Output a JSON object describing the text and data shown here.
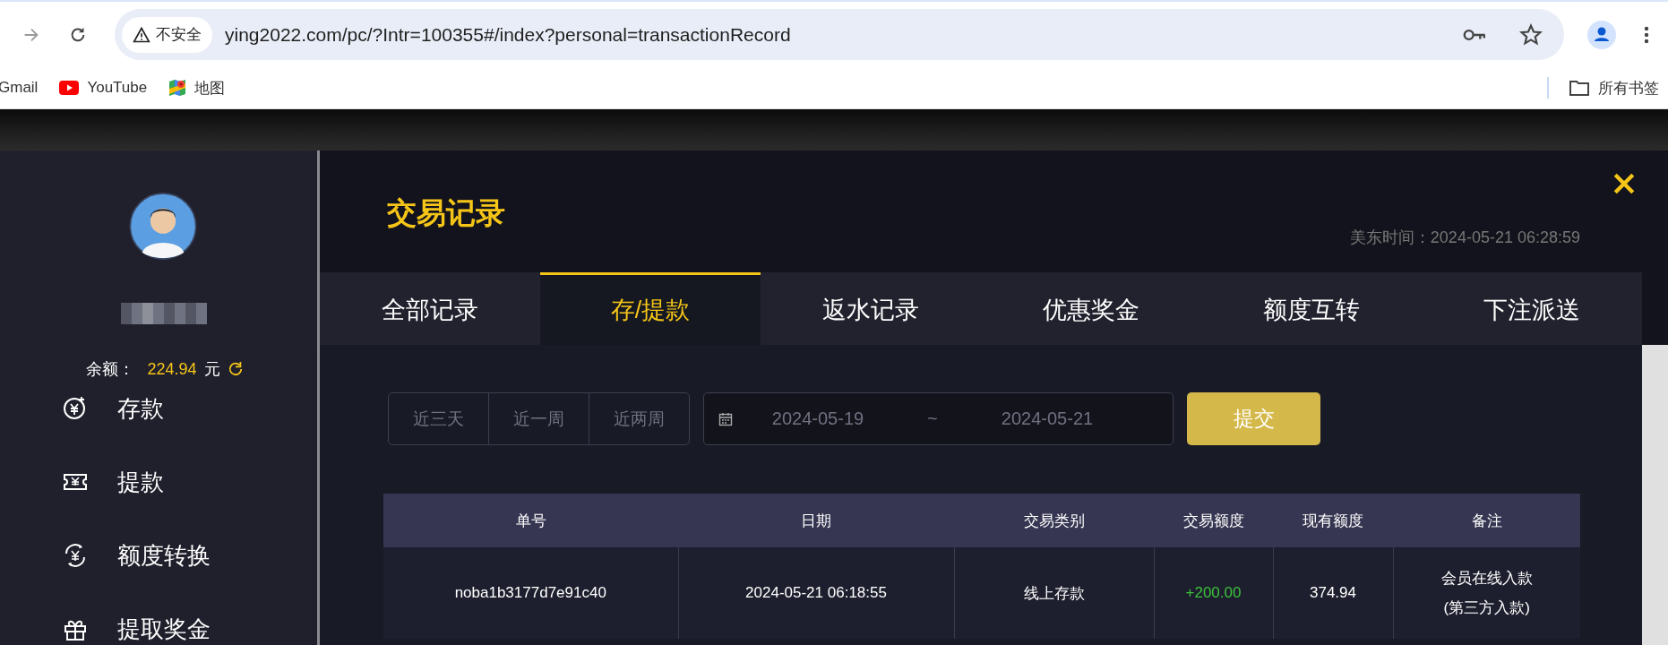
{
  "browser": {
    "security_label": "不安全",
    "url": "ying2022.com/pc/?Intr=100355#/index?personal=transactionRecord",
    "bookmarks": [
      {
        "label": "Gmail",
        "kind": "plain"
      },
      {
        "label": "YouTube",
        "kind": "youtube"
      },
      {
        "label": "地图",
        "kind": "maps"
      }
    ],
    "all_bookmarks": "所有书签"
  },
  "sidebar": {
    "balance_label": "余额：",
    "balance": "224.94",
    "currency": "元",
    "menu": [
      {
        "label": "存款",
        "kind": "deposit"
      },
      {
        "label": "提款",
        "kind": "withdraw"
      },
      {
        "label": "额度转换",
        "kind": "transfer"
      },
      {
        "label": "提取奖金",
        "kind": "gift"
      }
    ]
  },
  "panel": {
    "title": "交易记录",
    "time": "美东时间：2024-05-21 06:28:59",
    "tabs": [
      {
        "label": "全部记录",
        "selected": false
      },
      {
        "label": "存/提款",
        "selected": true
      },
      {
        "label": "返水记录",
        "selected": false
      },
      {
        "label": "优惠奖金",
        "selected": false
      },
      {
        "label": "额度互转",
        "selected": false
      },
      {
        "label": "下注派送",
        "selected": false
      }
    ],
    "quick_ranges": [
      "近三天",
      "近一周",
      "近两周"
    ],
    "date_from": "2024-05-19",
    "date_separator": "~",
    "date_to": "2024-05-21",
    "submit": "提交"
  },
  "table": {
    "columns": [
      "单号",
      "日期",
      "交易类别",
      "交易额度",
      "现有额度",
      "备注"
    ],
    "rows": [
      {
        "cells": [
          "noba1b3177d7e91c40",
          "2024-05-21 06:18:55",
          "线上存款",
          "+200.00",
          "374.94",
          "会员在线入款(第三方入款)"
        ],
        "kind": "credit"
      }
    ]
  }
}
